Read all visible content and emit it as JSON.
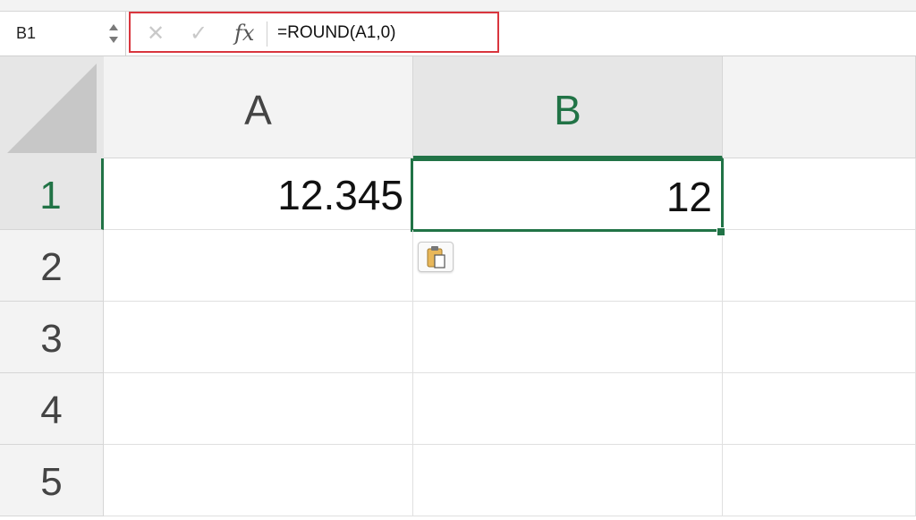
{
  "name_box": {
    "value": "B1"
  },
  "formula_bar": {
    "cancel_icon": "close-icon",
    "enter_icon": "check-icon",
    "fx_label": "fx",
    "formula": "=ROUND(A1,0)"
  },
  "columns": [
    {
      "label": "A",
      "selected": false
    },
    {
      "label": "B",
      "selected": true
    }
  ],
  "rows": [
    "1",
    "2",
    "3",
    "4",
    "5"
  ],
  "cells": {
    "A1": "12.345",
    "B1": "12"
  },
  "paste_options_icon": "clipboard-icon",
  "colors": {
    "accent": "#217346",
    "highlight": "#d9363e"
  }
}
